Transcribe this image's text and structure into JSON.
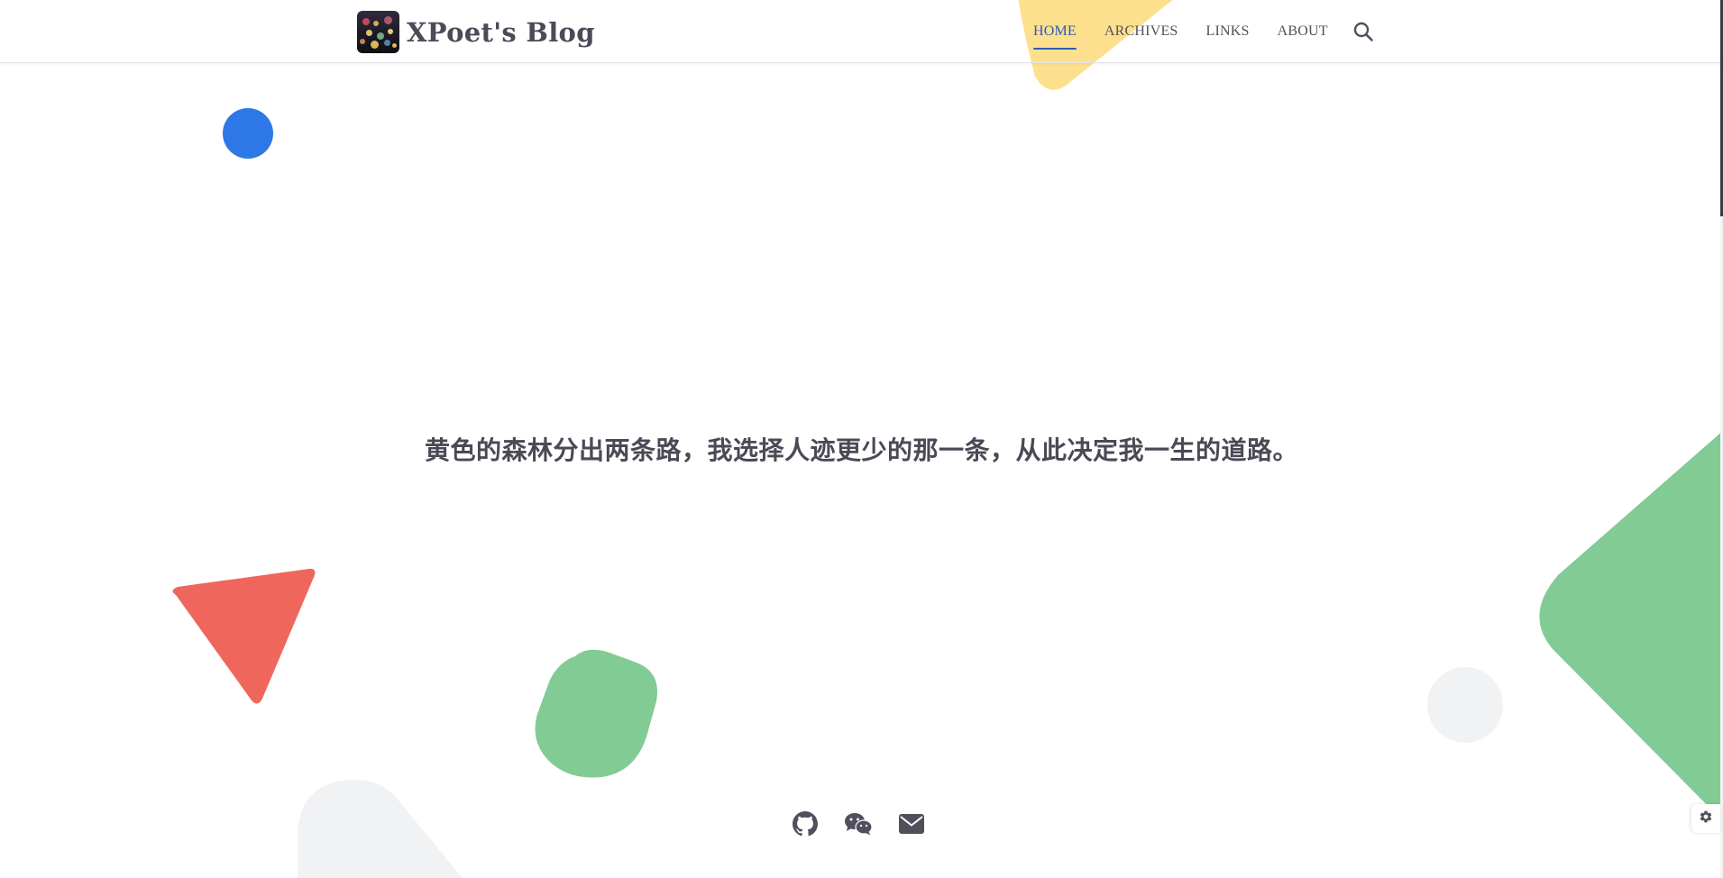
{
  "header": {
    "site_title": "XPoet's Blog",
    "nav": [
      {
        "label": "HOME",
        "active": true
      },
      {
        "label": "ARCHIVES",
        "active": false
      },
      {
        "label": "LINKS",
        "active": false
      },
      {
        "label": "ABOUT",
        "active": false
      }
    ],
    "search_icon": "search-icon"
  },
  "hero": {
    "quote": "黄色的森林分出两条路，我选择人迹更少的那一条，从此决定我一生的道路。"
  },
  "socials": [
    {
      "icon": "github-icon"
    },
    {
      "icon": "wechat-icon"
    },
    {
      "icon": "email-icon"
    }
  ],
  "settings": {
    "icon": "gear-icon"
  },
  "colors": {
    "accent": "#2d5bb5",
    "text": "#50505c",
    "yellow": "#fde08e",
    "blue": "#2d77e6",
    "red": "#ef675c",
    "green": "#82cb94",
    "gray": "#f1f2f4"
  }
}
